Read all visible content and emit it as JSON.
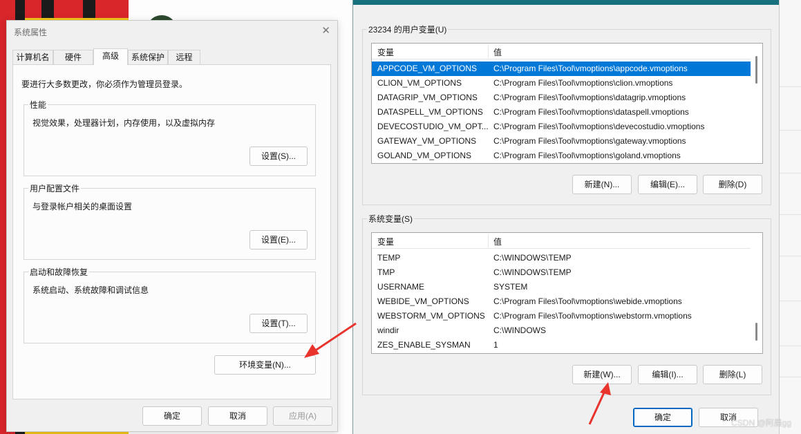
{
  "system_properties": {
    "title": "系统属性",
    "close_glyph": "✕",
    "tabs": [
      "计算机名",
      "硬件",
      "高级",
      "系统保护",
      "远程"
    ],
    "active_tab": "高级",
    "intro": "要进行大多数更改，你必须作为管理员登录。",
    "groups": {
      "performance": {
        "label": "性能",
        "desc": "视觉效果，处理器计划，内存使用，以及虚拟内存",
        "button": "设置(S)..."
      },
      "user_profiles": {
        "label": "用户配置文件",
        "desc": "与登录帐户相关的桌面设置",
        "button": "设置(E)..."
      },
      "startup_recovery": {
        "label": "启动和故障恢复",
        "desc": "系统启动、系统故障和调试信息",
        "button": "设置(T)..."
      }
    },
    "env_button": "环境变量(N)...",
    "ok": "确定",
    "cancel": "取消",
    "apply": "应用(A)"
  },
  "environment_variables": {
    "user_section": {
      "label": "23234 的用户变量(U)",
      "col_var": "变量",
      "col_val": "值",
      "rows": [
        {
          "var": "APPCODE_VM_OPTIONS",
          "val": "C:\\Program Files\\Tool\\vmoptions\\appcode.vmoptions",
          "selected": true
        },
        {
          "var": "CLION_VM_OPTIONS",
          "val": "C:\\Program Files\\Tool\\vmoptions\\clion.vmoptions"
        },
        {
          "var": "DATAGRIP_VM_OPTIONS",
          "val": "C:\\Program Files\\Tool\\vmoptions\\datagrip.vmoptions"
        },
        {
          "var": "DATASPELL_VM_OPTIONS",
          "val": "C:\\Program Files\\Tool\\vmoptions\\dataspell.vmoptions"
        },
        {
          "var": "DEVECOSTUDIO_VM_OPT...",
          "val": "C:\\Program Files\\Tool\\vmoptions\\devecostudio.vmoptions"
        },
        {
          "var": "GATEWAY_VM_OPTIONS",
          "val": "C:\\Program Files\\Tool\\vmoptions\\gateway.vmoptions"
        },
        {
          "var": "GOLAND_VM_OPTIONS",
          "val": "C:\\Program Files\\Tool\\vmoptions\\goland.vmoptions"
        }
      ],
      "new_button": "新建(N)...",
      "edit_button": "编辑(E)...",
      "delete_button": "删除(D)"
    },
    "system_section": {
      "label": "系统变量(S)",
      "col_var": "变量",
      "col_val": "值",
      "rows": [
        {
          "var": "TEMP",
          "val": "C:\\WINDOWS\\TEMP"
        },
        {
          "var": "TMP",
          "val": "C:\\WINDOWS\\TEMP"
        },
        {
          "var": "USERNAME",
          "val": "SYSTEM"
        },
        {
          "var": "WEBIDE_VM_OPTIONS",
          "val": "C:\\Program Files\\Tool\\vmoptions\\webide.vmoptions"
        },
        {
          "var": "WEBSTORM_VM_OPTIONS",
          "val": "C:\\Program Files\\Tool\\vmoptions\\webstorm.vmoptions"
        },
        {
          "var": "windir",
          "val": "C:\\WINDOWS"
        },
        {
          "var": "ZES_ENABLE_SYSMAN",
          "val": "1"
        }
      ],
      "new_button": "新建(W)...",
      "edit_button": "编辑(I)...",
      "delete_button": "删除(L)"
    },
    "ok": "确定",
    "cancel": "取消"
  },
  "watermark": "CSDN @阿晨gg",
  "colors": {
    "selection": "#0078d7",
    "annotation_arrow": "#e8342d",
    "title_accent": "#16707e"
  }
}
